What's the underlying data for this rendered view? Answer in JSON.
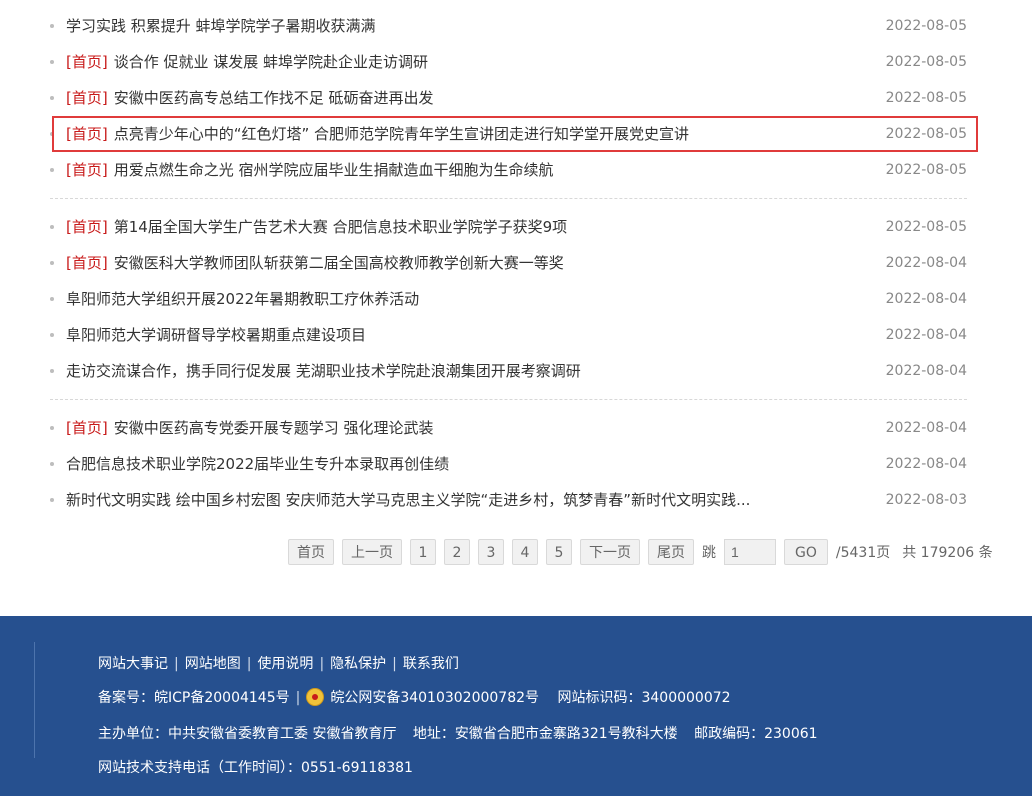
{
  "news": {
    "groups": [
      [
        {
          "tag": "",
          "title": "学习实践 积累提升 蚌埠学院学子暑期收获满满",
          "date": "2022-08-05"
        },
        {
          "tag": "[首页]",
          "title": "谈合作 促就业 谋发展 蚌埠学院赴企业走访调研",
          "date": "2022-08-05"
        },
        {
          "tag": "[首页]",
          "title": "安徽中医药高专总结工作找不足 砥砺奋进再出发",
          "date": "2022-08-05"
        },
        {
          "tag": "[首页]",
          "title": "点亮青少年心中的“红色灯塔” 合肥师范学院青年学生宣讲团走进行知学堂开展党史宣讲",
          "date": "2022-08-05"
        },
        {
          "tag": "[首页]",
          "title": "用爱点燃生命之光 宿州学院应届毕业生捐献造血干细胞为生命续航",
          "date": "2022-08-05"
        }
      ],
      [
        {
          "tag": "[首页]",
          "title": "第14届全国大学生广告艺术大赛 合肥信息技术职业学院学子获奖9项",
          "date": "2022-08-05"
        },
        {
          "tag": "[首页]",
          "title": "安徽医科大学教师团队斩获第二届全国高校教师教学创新大赛一等奖",
          "date": "2022-08-04"
        },
        {
          "tag": "",
          "title": "阜阳师范大学组织开展2022年暑期教职工疗休养活动",
          "date": "2022-08-04"
        },
        {
          "tag": "",
          "title": "阜阳师范大学调研督导学校暑期重点建设项目",
          "date": "2022-08-04"
        },
        {
          "tag": "",
          "title": "走访交流谋合作，携手同行促发展 芜湖职业技术学院赴浪潮集团开展考察调研",
          "date": "2022-08-04"
        }
      ],
      [
        {
          "tag": "[首页]",
          "title": "安徽中医药高专党委开展专题学习 强化理论武装",
          "date": "2022-08-04"
        },
        {
          "tag": "",
          "title": "合肥信息技术职业学院2022届毕业生专升本录取再创佳绩",
          "date": "2022-08-04"
        },
        {
          "tag": "",
          "title": "新时代文明实践 绘中国乡村宏图 安庆师范大学马克思主义学院“走进乡村，筑梦青春”新时代文明实践...",
          "date": "2022-08-03"
        }
      ]
    ]
  },
  "pager": {
    "first": "首页",
    "prev": "上一页",
    "pages": [
      "1",
      "2",
      "3",
      "4",
      "5"
    ],
    "next": "下一页",
    "last": "尾页",
    "jump_label": "跳",
    "jump_value": "1",
    "go": "GO",
    "total_pages": "/5431页",
    "total_items": "共 179206 条"
  },
  "footer": {
    "links": [
      "网站大事记",
      "网站地图",
      "使用说明",
      "隐私保护",
      "联系我们"
    ],
    "icp": "备案号：皖ICP备20004145号",
    "police": "皖公网安备34010302000782号",
    "site_id": "网站标识码：3400000072",
    "sponsor": "主办单位：中共安徽省委教育工委 安徽省教育厅",
    "address": "地址：安徽省合肥市金寨路321号教科大楼",
    "postcode": "邮政编码：230061",
    "support": "网站技术支持电话（工作时间）：0551-69118381"
  },
  "colors": {
    "tag": "#c81a1a",
    "footer_bg": "#26508f",
    "highlight": "#e03b3b"
  },
  "icons": {
    "police": "police-badge-icon"
  }
}
